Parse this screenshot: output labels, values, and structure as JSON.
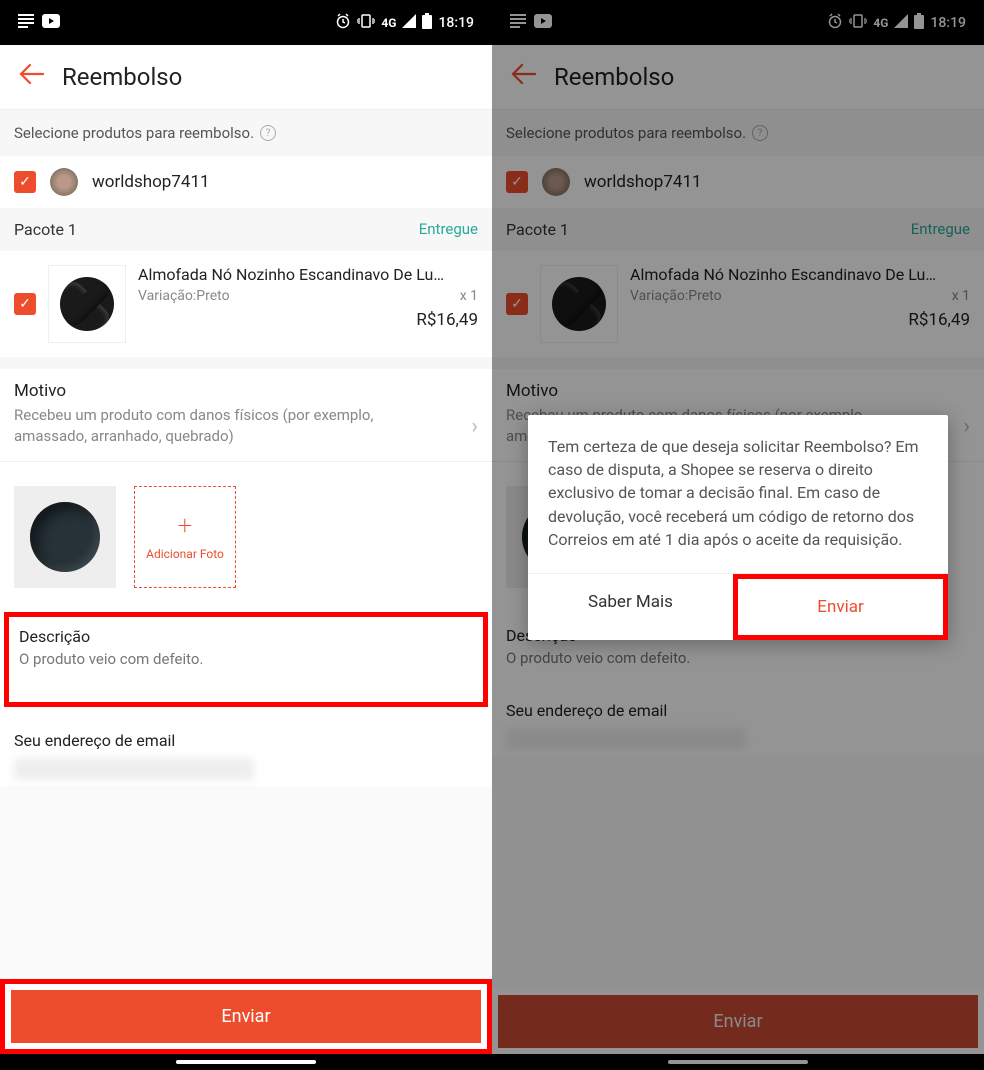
{
  "statusbar": {
    "time": "18:19",
    "network": "4G",
    "icons": {
      "reader": "☰",
      "youtube": "▶",
      "alarm": "⏰",
      "vibrate": "📳",
      "signal": "◢",
      "battery": "🔋"
    }
  },
  "header": {
    "title": "Reembolso"
  },
  "info_text": "Selecione produtos para reembolso.",
  "shop": {
    "name": "worldshop7411"
  },
  "package": {
    "label": "Pacote 1",
    "status": "Entregue"
  },
  "product": {
    "title": "Almofada Nó Nozinho Escandinavo De Lu…",
    "variation_label": "Variação:",
    "variation_value": "Preto",
    "quantity": "x 1",
    "price": "R$16,49"
  },
  "reason": {
    "header": "Motivo",
    "text": "Recebeu um produto com danos físicos (por exemplo, amassado, arranhado, quebrado)"
  },
  "photos": {
    "add_label": "Adicionar Foto"
  },
  "description": {
    "label": "Descrição",
    "text": "O produto veio com defeito."
  },
  "email": {
    "label": "Seu endereço de email"
  },
  "submit_label": "Enviar",
  "dialog": {
    "body": "Tem certeza de que deseja solicitar Reembolso? Em caso de disputa, a Shopee se reserva o direito exclusivo de tomar a decisão final. Em caso de devolução, você receberá um código de retorno dos Correios em até 1 dia após o aceite da requisição.",
    "learn_more": "Saber Mais",
    "send": "Enviar"
  }
}
